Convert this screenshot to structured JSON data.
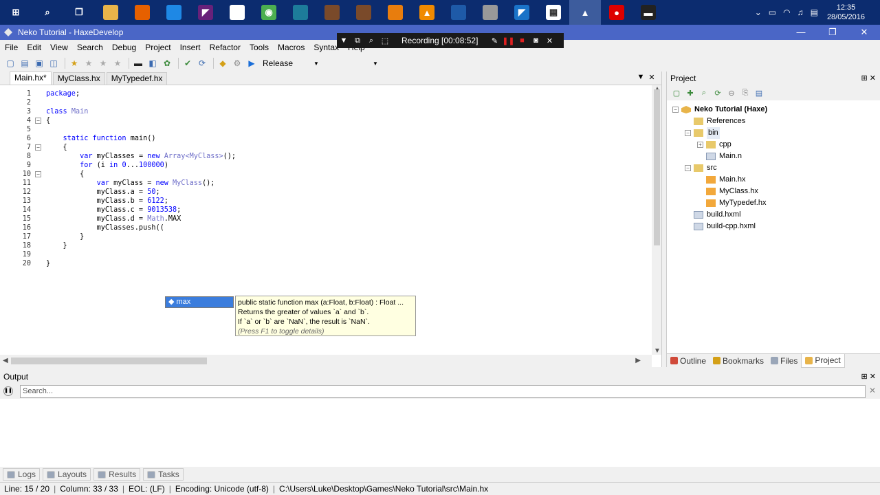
{
  "taskbar": {
    "icons": [
      "windows-start",
      "search",
      "task-view",
      "file-explorer",
      "firefox",
      "app",
      "visual-studio",
      "file",
      "chrome",
      "app",
      "app",
      "app",
      "blender",
      "vlc",
      "app",
      "app",
      "vscode",
      "calendar",
      "haxedevelop",
      "record",
      "terminal"
    ],
    "tray_time": "12:35",
    "tray_date": "28/05/2016"
  },
  "window": {
    "title": "Neko Tutorial - HaxeDevelop",
    "min": "—",
    "max": "❐",
    "close": "✕"
  },
  "recording": {
    "label": "Recording [00:08:52]"
  },
  "menu": [
    "File",
    "Edit",
    "View",
    "Search",
    "Debug",
    "Project",
    "Insert",
    "Refactor",
    "Tools",
    "Macros",
    "Syntax",
    "Help"
  ],
  "toolbar": {
    "config": "Release"
  },
  "editor": {
    "tabs": [
      "Main.hx*",
      "MyClass.hx",
      "MyTypedef.hx"
    ],
    "lines": [
      {
        "n": "1",
        "fold": "",
        "html": "package;"
      },
      {
        "n": "2",
        "fold": "",
        "html": ""
      },
      {
        "n": "3",
        "fold": "",
        "html": "class Main"
      },
      {
        "n": "4",
        "fold": "−",
        "html": "{"
      },
      {
        "n": "5",
        "fold": "",
        "html": ""
      },
      {
        "n": "6",
        "fold": "",
        "html": "    static function main()"
      },
      {
        "n": "7",
        "fold": "−",
        "html": "    {"
      },
      {
        "n": "8",
        "fold": "",
        "html": "        var myClasses = new Array<MyClass>();"
      },
      {
        "n": "9",
        "fold": "",
        "html": "        for (i in 0...100000)"
      },
      {
        "n": "10",
        "fold": "−",
        "html": "        {"
      },
      {
        "n": "11",
        "fold": "",
        "html": "            var myClass = new MyClass();"
      },
      {
        "n": "12",
        "fold": "",
        "html": "            myClass.a = 50;"
      },
      {
        "n": "13",
        "fold": "",
        "html": "            myClass.b = 6122;"
      },
      {
        "n": "14",
        "fold": "",
        "html": "            myClass.c = 9013538;"
      },
      {
        "n": "15",
        "fold": "",
        "html": "            myClass.d = Math.MAX"
      },
      {
        "n": "16",
        "fold": "",
        "html": "            myClasses.push(("
      },
      {
        "n": "17",
        "fold": "",
        "html": "        }"
      },
      {
        "n": "18",
        "fold": "",
        "html": "    }"
      },
      {
        "n": "19",
        "fold": "",
        "html": ""
      },
      {
        "n": "20",
        "fold": "",
        "html": "}"
      }
    ]
  },
  "autocomplete": {
    "item": "max",
    "tip_lines": [
      "public static function max (a:Float, b:Float) : Float ...",
      "Returns the greater of values `a` and `b`.",
      "If `a` or `b` are `NaN`, the result is `NaN`."
    ],
    "tip_hint": "(Press F1 to toggle details)"
  },
  "project": {
    "title": "Project",
    "tree": [
      {
        "label": "Neko Tutorial (Haxe)",
        "level": 0,
        "toggle": "−",
        "icon": "box",
        "bold": true
      },
      {
        "label": "References",
        "level": 1,
        "toggle": "",
        "icon": "folder"
      },
      {
        "label": "bin",
        "level": 1,
        "toggle": "−",
        "icon": "folder"
      },
      {
        "label": "cpp",
        "level": 2,
        "toggle": "+",
        "icon": "folder"
      },
      {
        "label": "Main.n",
        "level": 2,
        "toggle": "",
        "icon": "file"
      },
      {
        "label": "src",
        "level": 1,
        "toggle": "−",
        "icon": "folder"
      },
      {
        "label": "Main.hx",
        "level": 2,
        "toggle": "",
        "icon": "hx"
      },
      {
        "label": "MyClass.hx",
        "level": 2,
        "toggle": "",
        "icon": "hx"
      },
      {
        "label": "MyTypedef.hx",
        "level": 2,
        "toggle": "",
        "icon": "hx"
      },
      {
        "label": "build.hxml",
        "level": 1,
        "toggle": "",
        "icon": "file"
      },
      {
        "label": "build-cpp.hxml",
        "level": 1,
        "toggle": "",
        "icon": "file"
      }
    ],
    "tabs": [
      "Outline",
      "Bookmarks",
      "Files",
      "Project"
    ]
  },
  "output": {
    "title": "Output",
    "search_placeholder": "Search...",
    "tabs": [
      "Logs",
      "Layouts",
      "Results",
      "Tasks"
    ]
  },
  "status": {
    "line": "Line: 15 / 20",
    "column": "Column: 33 / 33",
    "eol": "EOL: (LF)",
    "encoding": "Encoding: Unicode (utf-8)",
    "path": "C:\\Users\\Luke\\Desktop\\Games\\Neko Tutorial\\src\\Main.hx"
  }
}
